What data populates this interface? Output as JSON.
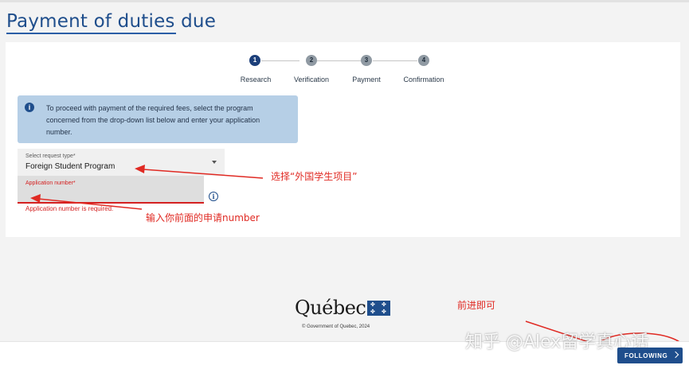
{
  "header": {
    "title": "Payment of duties due"
  },
  "stepper": {
    "steps": [
      {
        "number": "1",
        "label": "Research",
        "active": true
      },
      {
        "number": "2",
        "label": "Verification",
        "active": false
      },
      {
        "number": "3",
        "label": "Payment",
        "active": false
      },
      {
        "number": "4",
        "label": "Confirmation",
        "active": false
      }
    ]
  },
  "info": {
    "icon": "info-icon",
    "text": "To proceed with payment of the required fees, select the program concerned from the drop-down list below and enter your application number."
  },
  "form": {
    "request_type_label": "Select request type*",
    "request_type_value": "Foreign Student Program",
    "application_label": "Application number*",
    "application_value": "",
    "error": "Application number is required."
  },
  "annotations": {
    "select_note": "选择“外国学生项目”",
    "input_note": "输入你前面的申请number",
    "next_note": "前进即可"
  },
  "footer": {
    "logo_text": "Québec",
    "copyright": "© Government of Quebec, 2024",
    "following_label": "FOLLOWING",
    "watermark": "知乎 @Alex留学真心话"
  },
  "colors": {
    "primary": "#1f4e8c",
    "info_bg": "#b6cfe6",
    "error": "#d42020",
    "annotation": "#e02a23"
  }
}
